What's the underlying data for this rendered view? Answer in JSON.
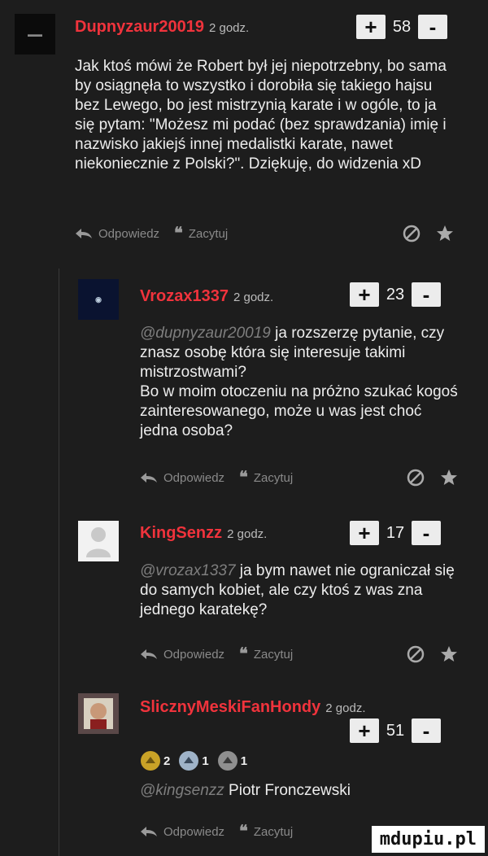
{
  "watermark": "mdupiu.pl",
  "actions": {
    "reply": "Odpowiedz",
    "quote": "Zacytuj"
  },
  "colors": {
    "username": "#f0333c",
    "background": "#1d1d1d"
  },
  "comments": [
    {
      "username": "Dupnyzaur20019",
      "time": "2 godz.",
      "score": "58",
      "plus": "+",
      "minus": "-",
      "text": "Jak ktoś mówi że Robert był jej niepotrzebny, bo sama by osiągnęła to wszystko i dorobiła się takiego hajsu bez Lewego, bo jest mistrzynią karate i w ogóle, to ja się pytam: \"Możesz mi podać (bez sprawdzania) imię i nazwisko jakiejś innej medalistki karate, nawet niekoniecznie z Polski?\". Dziękuję, do widzenia xD"
    },
    {
      "username": "Vrozax1337",
      "time": "2 godz.",
      "score": "23",
      "plus": "+",
      "minus": "-",
      "mention": "@dupnyzaur20019",
      "text": " ja rozszerzę pytanie, czy znasz osobę która się interesuje takimi mistrzostwami?",
      "text2": "Bo w moim otoczeniu na próżno szukać kogoś zainteresowanego, może u was jest choć jedna osoba?"
    },
    {
      "username": "KingSenzz",
      "time": "2 godz.",
      "score": "17",
      "plus": "+",
      "minus": "-",
      "mention": "@vrozax1337",
      "text": " ja bym nawet nie ograniczał się do samych kobiet, ale czy ktoś z was zna jednego karatekę?"
    },
    {
      "username": "SlicznyMeskiFanHondy",
      "time": "2 godz.",
      "score": "51",
      "plus": "+",
      "minus": "-",
      "badges": [
        "2",
        "1",
        "1"
      ],
      "mention": "@kingsenzz",
      "text": " Piotr Fronczewski"
    }
  ]
}
